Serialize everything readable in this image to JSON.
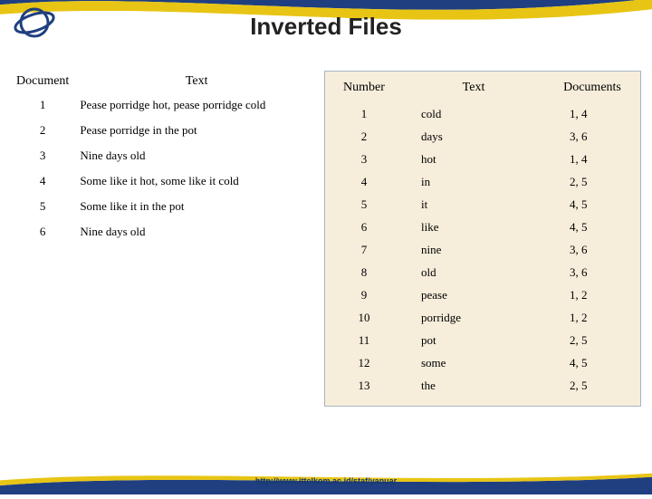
{
  "title": "Inverted Files",
  "footer_url": "http://www.ittelkom.ac.id/staf/yanuar",
  "left": {
    "headers": [
      "Document",
      "Text"
    ],
    "rows": [
      {
        "doc": "1",
        "text": "Pease porridge hot, pease porridge cold"
      },
      {
        "doc": "2",
        "text": "Pease porridge in the pot"
      },
      {
        "doc": "3",
        "text": "Nine days old"
      },
      {
        "doc": "4",
        "text": "Some like it hot, some like it cold"
      },
      {
        "doc": "5",
        "text": "Some like it in the pot"
      },
      {
        "doc": "6",
        "text": "Nine days old"
      }
    ]
  },
  "right": {
    "headers": [
      "Number",
      "Text",
      "Documents"
    ],
    "rows": [
      {
        "num": "1",
        "text": "cold",
        "docs": "1, 4"
      },
      {
        "num": "2",
        "text": "days",
        "docs": "3, 6"
      },
      {
        "num": "3",
        "text": "hot",
        "docs": "1, 4"
      },
      {
        "num": "4",
        "text": "in",
        "docs": "2, 5"
      },
      {
        "num": "5",
        "text": "it",
        "docs": "4, 5"
      },
      {
        "num": "6",
        "text": "like",
        "docs": "4, 5"
      },
      {
        "num": "7",
        "text": "nine",
        "docs": "3, 6"
      },
      {
        "num": "8",
        "text": "old",
        "docs": "3, 6"
      },
      {
        "num": "9",
        "text": "pease",
        "docs": "1, 2"
      },
      {
        "num": "10",
        "text": "porridge",
        "docs": "1, 2"
      },
      {
        "num": "11",
        "text": "pot",
        "docs": "2, 5"
      },
      {
        "num": "12",
        "text": "some",
        "docs": "4, 5"
      },
      {
        "num": "13",
        "text": "the",
        "docs": "2, 5"
      }
    ]
  }
}
